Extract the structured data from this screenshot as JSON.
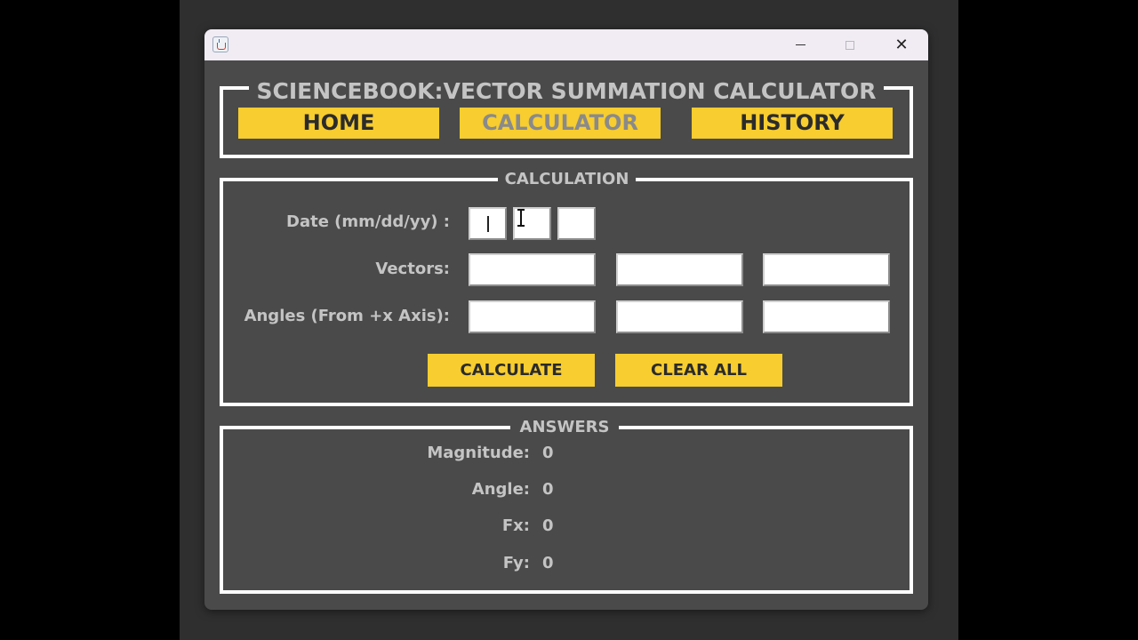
{
  "window": {
    "app_icon": "java-cup-icon",
    "controls": {
      "minimize": "minimize-icon",
      "maximize": "maximize-icon",
      "close": "close-icon",
      "close_glyph": "✕"
    }
  },
  "header": {
    "title": "SCIENCEBOOK:VECTOR SUMMATION CALCULATOR",
    "nav": {
      "home": "HOME",
      "calculator": "CALCULATOR",
      "history": "HISTORY"
    },
    "active_tab": "CALCULATOR"
  },
  "calculation": {
    "legend": "CALCULATION",
    "date_label": "Date (mm/dd/yy) :",
    "vectors_label": "Vectors:",
    "angles_label": "Angles (From +x Axis):",
    "date_values": [
      "",
      "",
      ""
    ],
    "vector_values": [
      "",
      "",
      ""
    ],
    "angle_values": [
      "",
      "",
      ""
    ],
    "calculate_label": "CALCULATE",
    "clear_label": "CLEAR ALL"
  },
  "answers": {
    "legend": "ANSWERS",
    "magnitude_label": "Magnitude:",
    "magnitude_value": "0",
    "angle_label": "Angle:",
    "angle_value": "0",
    "fx_label": "Fx:",
    "fx_value": "0",
    "fy_label": "Fy:",
    "fy_value": "0"
  },
  "colors": {
    "desktop": "#000000",
    "backdrop": "#2f2f2f",
    "window_bg": "#4a4a4a",
    "titlebar": "#f1ecf4",
    "accent_yellow": "#f7cd2f",
    "label_gray": "#c4c4c4",
    "frame_white": "#ffffff"
  }
}
